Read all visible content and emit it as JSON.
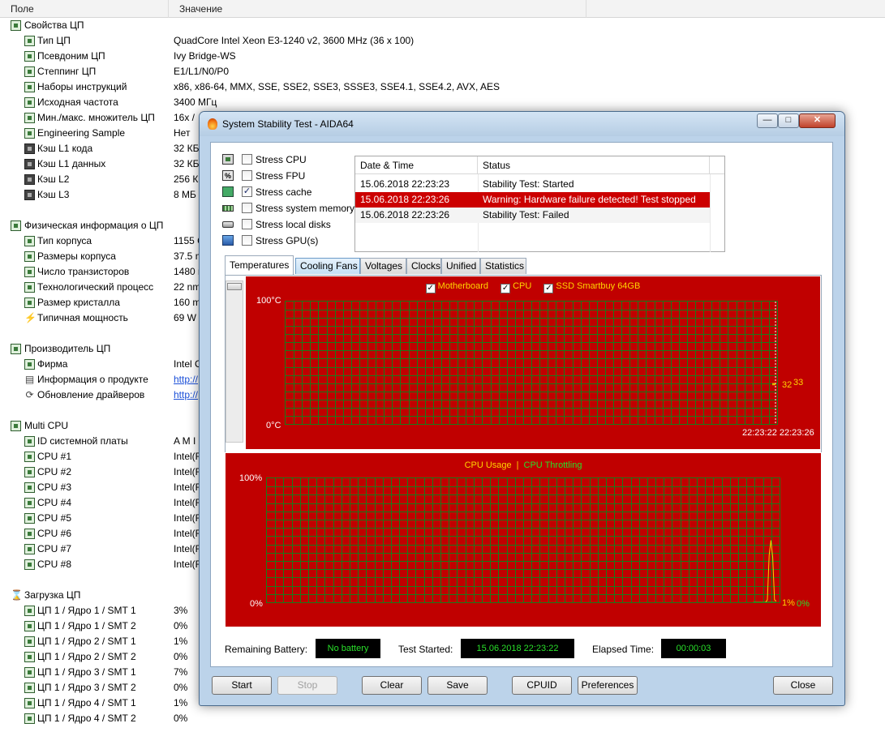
{
  "list": {
    "headers": {
      "field": "Поле",
      "value": "Значение"
    },
    "rows": [
      {
        "kind": "cat",
        "label": "Свойства ЦП",
        "value": ""
      },
      {
        "kind": "item",
        "label": "Тип ЦП",
        "value": "QuadCore Intel Xeon E3-1240 v2, 3600 MHz (36 x 100)"
      },
      {
        "kind": "item",
        "label": "Псевдоним ЦП",
        "value": "Ivy Bridge-WS"
      },
      {
        "kind": "item",
        "label": "Степпинг ЦП",
        "value": "E1/L1/N0/P0"
      },
      {
        "kind": "item",
        "label": "Наборы инструкций",
        "value": "x86, x86-64, MMX, SSE, SSE2, SSE3, SSSE3, SSE4.1, SSE4.2, AVX, AES"
      },
      {
        "kind": "item",
        "label": "Исходная частота",
        "value": "3400 МГц"
      },
      {
        "kind": "item",
        "label": "Мин./макс. множитель ЦП",
        "value": "16x /"
      },
      {
        "kind": "item",
        "label": "Engineering Sample",
        "value": "Нет"
      },
      {
        "kind": "item",
        "icon": "cache",
        "label": "Кэш L1 кода",
        "value": "32 КБ"
      },
      {
        "kind": "item",
        "icon": "cache",
        "label": "Кэш L1 данных",
        "value": "32 КБ"
      },
      {
        "kind": "item",
        "icon": "cache",
        "label": "Кэш L2",
        "value": "256 КБ"
      },
      {
        "kind": "item",
        "icon": "cache",
        "label": "Кэш L3",
        "value": "8 МБ"
      },
      {
        "kind": "gap"
      },
      {
        "kind": "cat",
        "label": "Физическая информация о ЦП",
        "value": ""
      },
      {
        "kind": "item",
        "label": "Тип корпуса",
        "value": "1155 C"
      },
      {
        "kind": "item",
        "label": "Размеры корпуса",
        "value": "37.5 m"
      },
      {
        "kind": "item",
        "label": "Число транзисторов",
        "value": "1480 m"
      },
      {
        "kind": "item",
        "label": "Технологический процесс",
        "value": "22 nm"
      },
      {
        "kind": "item",
        "label": "Размер кристалла",
        "value": "160 m"
      },
      {
        "kind": "item",
        "icon": "power",
        "label": "Типичная мощность",
        "value": "69 W"
      },
      {
        "kind": "gap"
      },
      {
        "kind": "cat",
        "label": "Производитель ЦП",
        "value": ""
      },
      {
        "kind": "item",
        "label": "Фирма",
        "value": "Intel C"
      },
      {
        "kind": "item",
        "icon": "info",
        "label": "Информация о продукте",
        "value": "http://",
        "link": true
      },
      {
        "kind": "item",
        "icon": "update",
        "label": "Обновление драйверов",
        "value": "http://",
        "link": true
      },
      {
        "kind": "gap"
      },
      {
        "kind": "cat",
        "label": "Multi CPU",
        "value": ""
      },
      {
        "kind": "item",
        "label": "ID системной платы",
        "value": "A M I"
      },
      {
        "kind": "item",
        "label": "CPU #1",
        "value": "Intel(R"
      },
      {
        "kind": "item",
        "label": "CPU #2",
        "value": "Intel(R"
      },
      {
        "kind": "item",
        "label": "CPU #3",
        "value": "Intel(R"
      },
      {
        "kind": "item",
        "label": "CPU #4",
        "value": "Intel(R"
      },
      {
        "kind": "item",
        "label": "CPU #5",
        "value": "Intel(R"
      },
      {
        "kind": "item",
        "label": "CPU #6",
        "value": "Intel(R"
      },
      {
        "kind": "item",
        "label": "CPU #7",
        "value": "Intel(R"
      },
      {
        "kind": "item",
        "label": "CPU #8",
        "value": "Intel(R"
      },
      {
        "kind": "gap"
      },
      {
        "kind": "cat",
        "icon": "hourglass",
        "label": "Загрузка ЦП",
        "value": ""
      },
      {
        "kind": "item",
        "label": "ЦП 1 / Ядро 1 / SMT 1",
        "value": "3%"
      },
      {
        "kind": "item",
        "label": "ЦП 1 / Ядро 1 / SMT 2",
        "value": "0%"
      },
      {
        "kind": "item",
        "label": "ЦП 1 / Ядро 2 / SMT 1",
        "value": "1%"
      },
      {
        "kind": "item",
        "label": "ЦП 1 / Ядро 2 / SMT 2",
        "value": "0%"
      },
      {
        "kind": "item",
        "label": "ЦП 1 / Ядро 3 / SMT 1",
        "value": "7%"
      },
      {
        "kind": "item",
        "label": "ЦП 1 / Ядро 3 / SMT 2",
        "value": "0%"
      },
      {
        "kind": "item",
        "label": "ЦП 1 / Ядро 4 / SMT 1",
        "value": "1%"
      },
      {
        "kind": "item",
        "label": "ЦП 1 / Ядро 4 / SMT 2",
        "value": "0%"
      }
    ]
  },
  "dialog": {
    "title": "System Stability Test - AIDA64",
    "window_buttons": {
      "minimize": "—",
      "maximize": "□",
      "close": "✕"
    },
    "stress_options": [
      {
        "label": "Stress CPU",
        "checked": false,
        "icon": "cpu-chip-icon"
      },
      {
        "label": "Stress FPU",
        "checked": false,
        "icon": "fpu-icon"
      },
      {
        "label": "Stress cache",
        "checked": true,
        "icon": "cache-icon"
      },
      {
        "label": "Stress system memory",
        "checked": false,
        "icon": "memory-icon"
      },
      {
        "label": "Stress local disks",
        "checked": false,
        "icon": "disk-icon"
      },
      {
        "label": "Stress GPU(s)",
        "checked": false,
        "icon": "gpu-icon"
      }
    ],
    "log": {
      "headers": {
        "date": "Date & Time",
        "status": "Status"
      },
      "rows": [
        {
          "date": "15.06.2018 22:23:23",
          "status": "Stability Test: Started",
          "error": false
        },
        {
          "date": "15.06.2018 22:23:26",
          "status": "Warning: Hardware failure detected! Test stopped",
          "error": true
        },
        {
          "date": "15.06.2018 22:23:26",
          "status": "Stability Test: Failed",
          "error": false
        }
      ]
    },
    "tabs": [
      "Temperatures",
      "Cooling Fans",
      "Voltages",
      "Clocks",
      "Unified",
      "Statistics"
    ],
    "active_tab": "Temperatures",
    "temp_chart": {
      "legend": [
        {
          "label": "Motherboard",
          "checked": true
        },
        {
          "label": "CPU",
          "checked": true
        },
        {
          "label": "SSD Smartbuy 64GB",
          "checked": true
        }
      ],
      "y_max": "100°C",
      "y_min": "0°C",
      "value_labels": [
        "32",
        "33"
      ],
      "time_start": "22:23:22",
      "time_end": "22:23:26"
    },
    "usage_chart": {
      "legend": [
        "CPU Usage",
        "CPU Throttling"
      ],
      "separator": "|",
      "y_max": "100%",
      "y_min": "0%",
      "usage_value": "1%",
      "throttle_value": "0%"
    },
    "status": {
      "battery_label": "Remaining Battery:",
      "battery_value": "No battery",
      "started_label": "Test Started:",
      "started_value": "15.06.2018 22:23:22",
      "elapsed_label": "Elapsed Time:",
      "elapsed_value": "00:00:03"
    },
    "buttons": {
      "start": "Start",
      "stop": "Stop",
      "clear": "Clear",
      "save": "Save",
      "cpuid": "CPUID",
      "preferences": "Preferences",
      "close": "Close"
    }
  },
  "chart_data": [
    {
      "type": "line",
      "title": "",
      "series": [
        {
          "name": "Motherboard",
          "values": [
            32,
            32,
            32,
            32,
            32
          ]
        },
        {
          "name": "CPU",
          "values": [
            33,
            33,
            33,
            33,
            33
          ]
        },
        {
          "name": "SSD Smartbuy 64GB",
          "values": [
            33,
            33,
            33,
            33,
            33
          ]
        }
      ],
      "x": [
        "22:23:22",
        "22:23:23",
        "22:23:24",
        "22:23:25",
        "22:23:26"
      ],
      "ylim": [
        0,
        100
      ],
      "ylabel": "°C",
      "grid": true
    },
    {
      "type": "line",
      "title": "",
      "series": [
        {
          "name": "CPU Usage",
          "values": [
            0,
            0,
            0,
            0,
            0,
            0,
            0,
            0,
            2,
            38,
            50,
            36,
            2,
            1
          ]
        },
        {
          "name": "CPU Throttling",
          "values": [
            0,
            0,
            0,
            0,
            0,
            0,
            0,
            0,
            0,
            0,
            0,
            0,
            0,
            0
          ]
        }
      ],
      "ylim": [
        0,
        100
      ],
      "ylabel": "%",
      "grid": true
    }
  ],
  "colors": {
    "chart_background": "#c00000",
    "grid": "#1a7a1a",
    "legend_text": "#ffd400",
    "usage_line": "#ffd400",
    "throttle_line": "#29e02a",
    "error_row": "#cc0000",
    "status_text": "#29e02a"
  }
}
